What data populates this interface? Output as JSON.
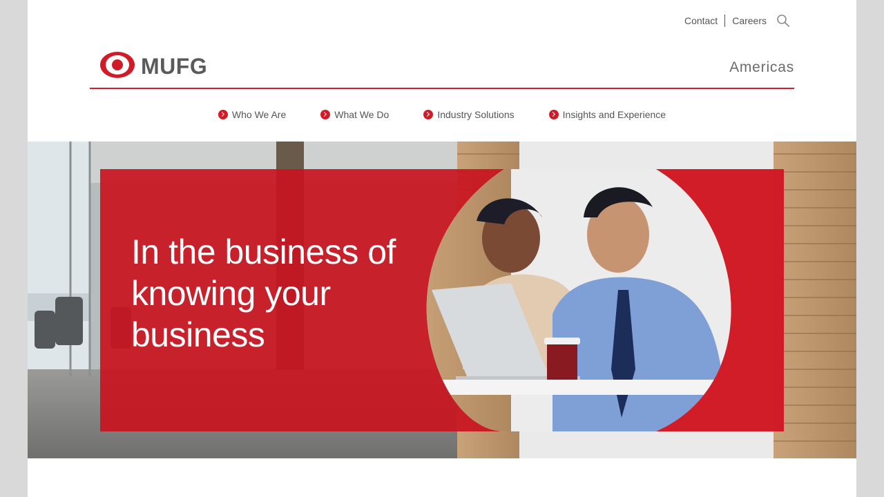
{
  "utility_nav": {
    "contact": "Contact",
    "careers": "Careers"
  },
  "header": {
    "logo_text": "MUFG",
    "region": "Americas"
  },
  "main_nav": {
    "items": [
      {
        "label": "Who We Are"
      },
      {
        "label": "What We Do"
      },
      {
        "label": "Industry Solutions"
      },
      {
        "label": "Insights and Experience"
      }
    ]
  },
  "hero": {
    "headline_line1": "In the business of",
    "headline_line2": "knowing your",
    "headline_line3": "business"
  },
  "colors": {
    "brand_red": "#d01c28",
    "text_gray": "#555555"
  },
  "icons": {
    "search": "search-icon",
    "nav_bullet": "chevron-right-circle-icon"
  }
}
